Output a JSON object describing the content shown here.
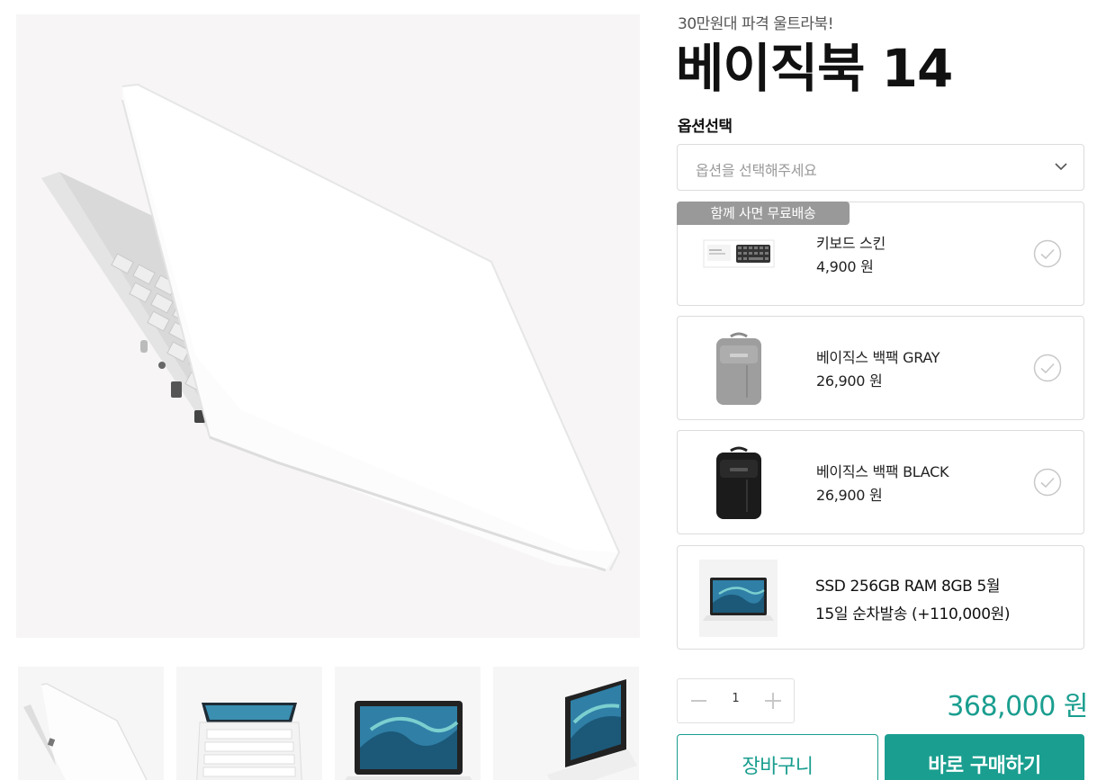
{
  "product": {
    "subtitle": "30만원대 파격 울트라북!",
    "title": "베이직북 14"
  },
  "options": {
    "label": "옵션선택",
    "placeholder": "옵션을 선택해주세요"
  },
  "addons": {
    "badge": "함께 사면 무료배송",
    "items": [
      {
        "name": "키보드 스킨",
        "price": "4,900 원",
        "image": "keyboard-skin"
      },
      {
        "name": "베이직스 백팩 GRAY",
        "price": "26,900 원",
        "image": "backpack-gray"
      },
      {
        "name": "베이직스 백팩 BLACK",
        "price": "26,900 원",
        "image": "backpack-black"
      }
    ]
  },
  "selected_option": {
    "line1": "SSD 256GB RAM 8GB 5월",
    "line2": "15일 순차발송 (+110,000원)"
  },
  "quantity": "1",
  "total_price": "368,000 원",
  "buttons": {
    "cart": "장바구니",
    "buy": "바로 구매하기"
  },
  "colors": {
    "accent": "#1a9e8f",
    "badge": "#999999",
    "border": "#dcdcdc"
  }
}
